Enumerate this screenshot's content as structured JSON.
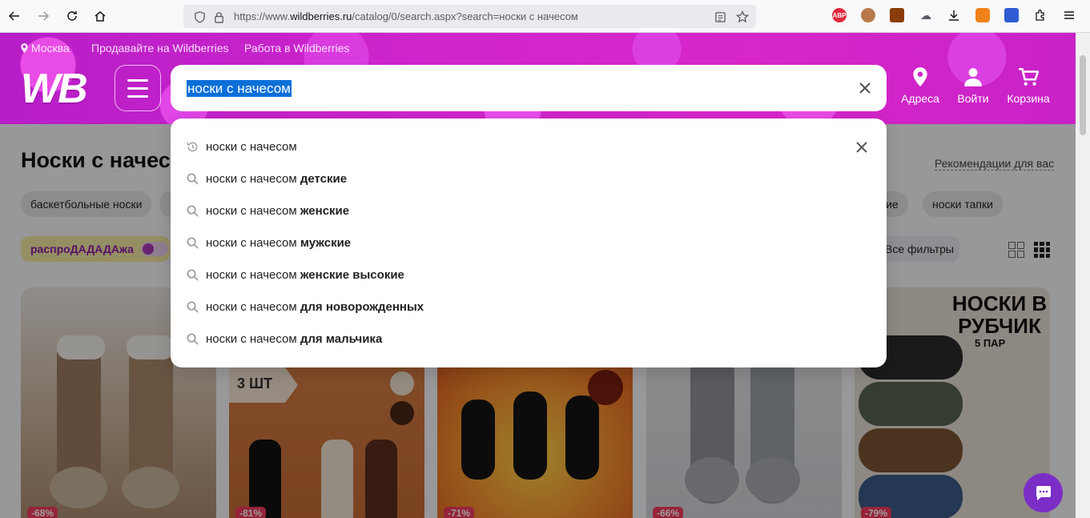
{
  "browser": {
    "url_prefix": "https://www.",
    "url_domain": "wildberries.ru",
    "url_path": "/catalog/0/search.aspx?search=носки с начесом",
    "ext_abp": "ABP"
  },
  "header": {
    "city": "Москва",
    "sell_link": "Продавайте на Wildberries",
    "jobs_link": "Работа в Wildberries",
    "logo": "WB",
    "search_query": "носки с начесом",
    "addresses": "Адреса",
    "login": "Войти",
    "cart": "Корзина"
  },
  "page": {
    "title": "Носки с начесом",
    "recommend": "Рекомендации для вас",
    "chips": [
      "баскетбольные носки",
      "кие",
      "носки тапки"
    ],
    "sale_label": "распроДАДАДАжа",
    "all_filters": "Все фильтры",
    "cards": [
      {
        "discount": "-68%",
        "color": "#b9a58f"
      },
      {
        "discount": "-81%",
        "color": "#c6713a",
        "badge": "3 ШТ"
      },
      {
        "discount": "-71%",
        "color": "#e1782b"
      },
      {
        "discount": "-66%",
        "color": "#d9d9de"
      },
      {
        "discount": "-79%",
        "color": "#cfc2b5",
        "title": "НОСКИ В РУБЧИК",
        "sub": "5 ПАР"
      }
    ]
  },
  "suggest": {
    "items": [
      {
        "base": "носки с начесом",
        "bold": "",
        "type": "history"
      },
      {
        "base": "носки с начесом ",
        "bold": "детские",
        "type": "search"
      },
      {
        "base": "носки с начесом ",
        "bold": "женские",
        "type": "search"
      },
      {
        "base": "носки с начесом ",
        "bold": "мужские",
        "type": "search"
      },
      {
        "base": "носки с начесом ",
        "bold": "женские высокие",
        "type": "search"
      },
      {
        "base": "носки с начесом ",
        "bold": "для новорожденных",
        "type": "search"
      },
      {
        "base": "носки с начесом ",
        "bold": "для мальчика",
        "type": "search"
      }
    ]
  }
}
